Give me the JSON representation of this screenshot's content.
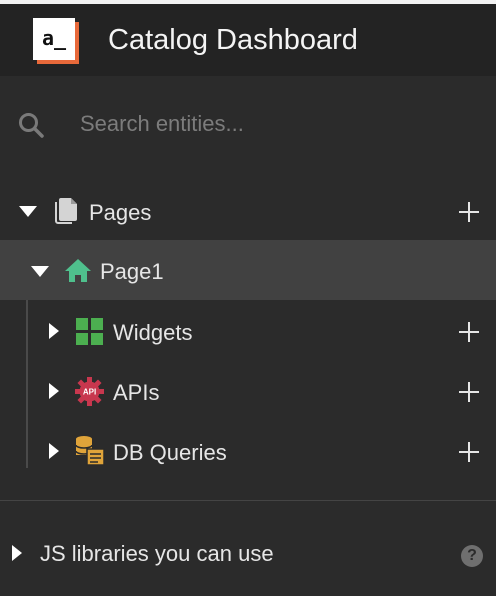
{
  "header": {
    "logo_text": "a_",
    "title": "Catalog Dashboard"
  },
  "search": {
    "placeholder": "Search entities..."
  },
  "tree": {
    "pages": {
      "label": "Pages",
      "expanded": true
    },
    "page1": {
      "label": "Page1",
      "expanded": true,
      "selected": true
    },
    "children": [
      {
        "label": "Widgets",
        "icon": "widgets-icon",
        "expanded": false
      },
      {
        "label": "APIs",
        "icon": "api-icon",
        "expanded": false
      },
      {
        "label": "DB Queries",
        "icon": "db-queries-icon",
        "expanded": false
      }
    ]
  },
  "footer": {
    "js_libraries_label": "JS libraries you can use",
    "help_glyph": "?"
  },
  "colors": {
    "background": "#2b2b2b",
    "header": "#232323",
    "selected_row": "#414141",
    "logo_accent": "#e8693a",
    "home_icon": "#4fc08d",
    "widgets_icon": "#4caf50",
    "api_icon": "#c8374e",
    "db_icon": "#e0a43a"
  }
}
